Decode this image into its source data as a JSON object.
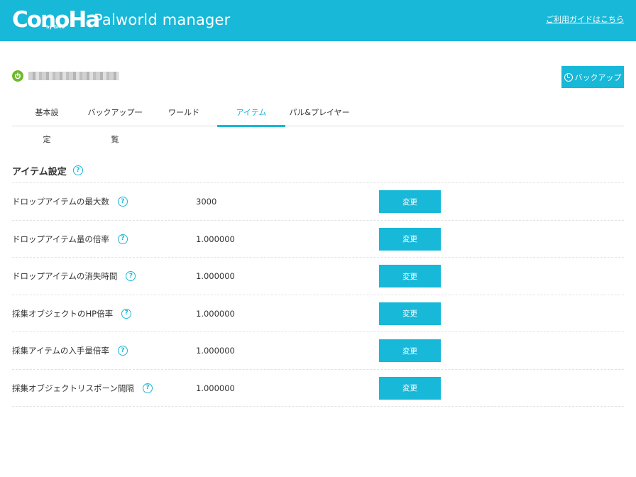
{
  "header": {
    "logo_text": "ConoHa",
    "logo_sub": "by GMO",
    "app_title": "Palworld manager",
    "guide_link": "ご利用ガイドはこちら"
  },
  "server": {
    "status": "power-on",
    "backup_label": "バックアップ"
  },
  "tabs": [
    {
      "label": "基本設定",
      "active": false
    },
    {
      "label": "バックアップ一覧",
      "active": false
    },
    {
      "label": "ワールド",
      "active": false
    },
    {
      "label": "アイテム",
      "active": true
    },
    {
      "label": "パル&プレイヤー",
      "active": false
    }
  ],
  "section": {
    "title": "アイテム設定"
  },
  "settings": [
    {
      "label": "ドロップアイテムの最大数",
      "value": "3000",
      "button": "変更"
    },
    {
      "label": "ドロップアイテム量の倍率",
      "value": "1.000000",
      "button": "変更"
    },
    {
      "label": "ドロップアイテムの消失時間",
      "value": "1.000000",
      "button": "変更"
    },
    {
      "label": "採集オブジェクトのHP倍率",
      "value": "1.000000",
      "button": "変更"
    },
    {
      "label": "採集アイテムの入手量倍率",
      "value": "1.000000",
      "button": "変更"
    },
    {
      "label": "採集オブジェクトリスポーン間隔",
      "value": "1.000000",
      "button": "変更"
    }
  ],
  "colors": {
    "accent": "#17b8d8",
    "status_on": "#6eb92b"
  },
  "icons": {
    "help": "question-circle-icon",
    "power": "power-icon",
    "backup": "backup-clock-icon"
  }
}
